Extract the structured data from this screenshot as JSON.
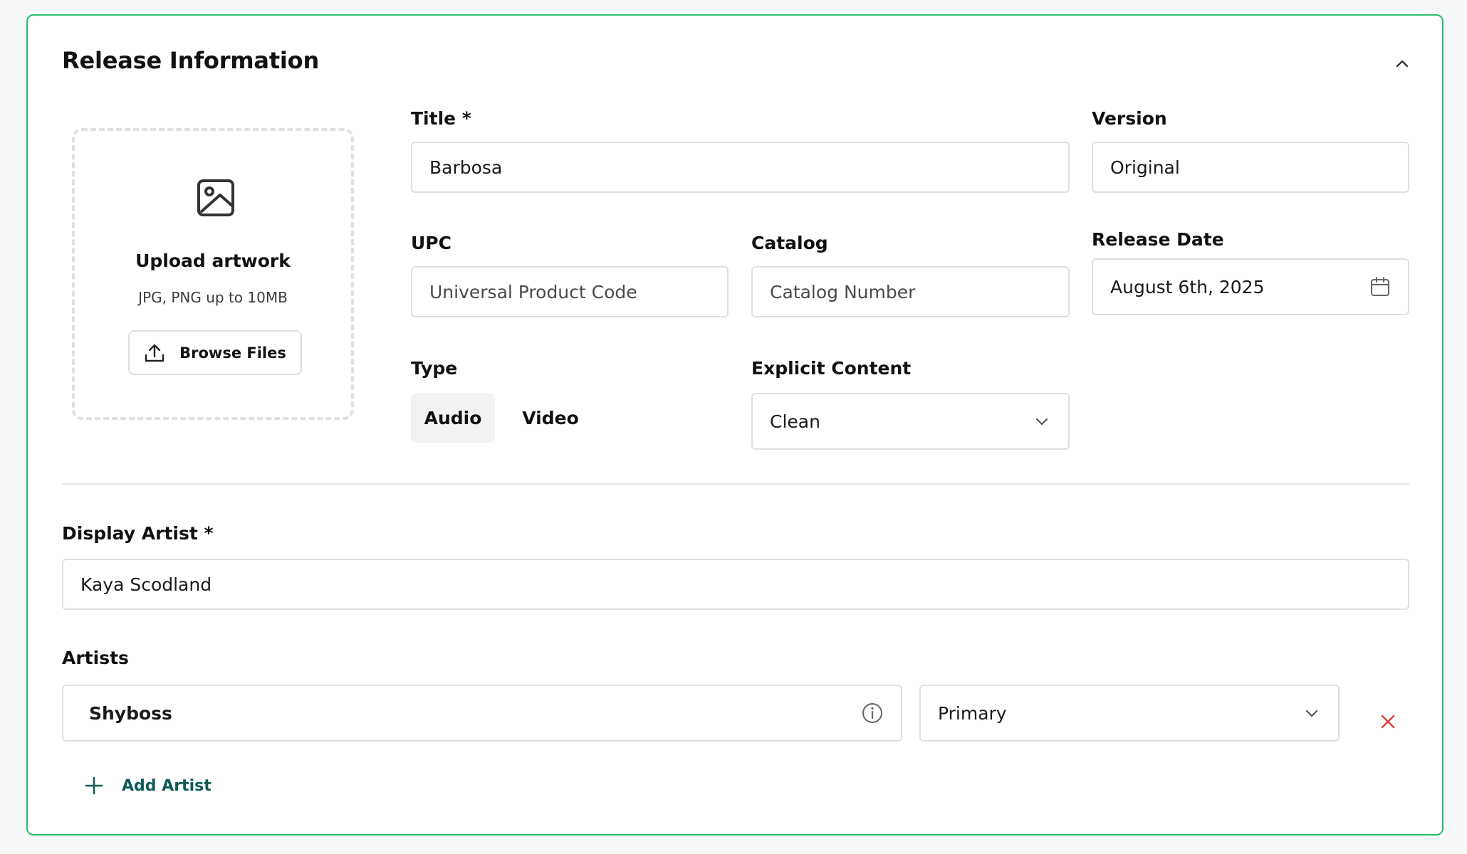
{
  "section": {
    "title": "Release Information"
  },
  "artwork": {
    "title": "Upload artwork",
    "hint": "JPG, PNG up to 10MB",
    "browse_label": "Browse Files"
  },
  "fields": {
    "title": {
      "label": "Title *",
      "value": "Barbosa"
    },
    "version": {
      "label": "Version",
      "value": "Original"
    },
    "upc": {
      "label": "UPC",
      "placeholder": "Universal Product Code",
      "value": ""
    },
    "catalog": {
      "label": "Catalog",
      "placeholder": "Catalog Number",
      "value": ""
    },
    "release_date": {
      "label": "Release Date",
      "value": "August 6th, 2025"
    },
    "type": {
      "label": "Type",
      "options": [
        "Audio",
        "Video"
      ],
      "selected": "Audio"
    },
    "explicit": {
      "label": "Explicit Content",
      "value": "Clean"
    },
    "display_artist": {
      "label": "Display Artist *",
      "value": "Kaya Scodland"
    }
  },
  "artists": {
    "label": "Artists",
    "items": [
      {
        "name": "Shyboss",
        "role": "Primary"
      }
    ],
    "add_label": "Add Artist"
  },
  "icons": {
    "collapse": "chevron-up-icon",
    "artwork": "image-icon",
    "upload": "upload-icon",
    "calendar": "calendar-icon",
    "dropdown": "chevron-down-icon",
    "info": "info-icon",
    "remove": "close-icon",
    "add": "plus-icon"
  },
  "colors": {
    "card_border": "#29c06a",
    "remove": "#e23b3b",
    "add_link": "#0f5b57"
  }
}
